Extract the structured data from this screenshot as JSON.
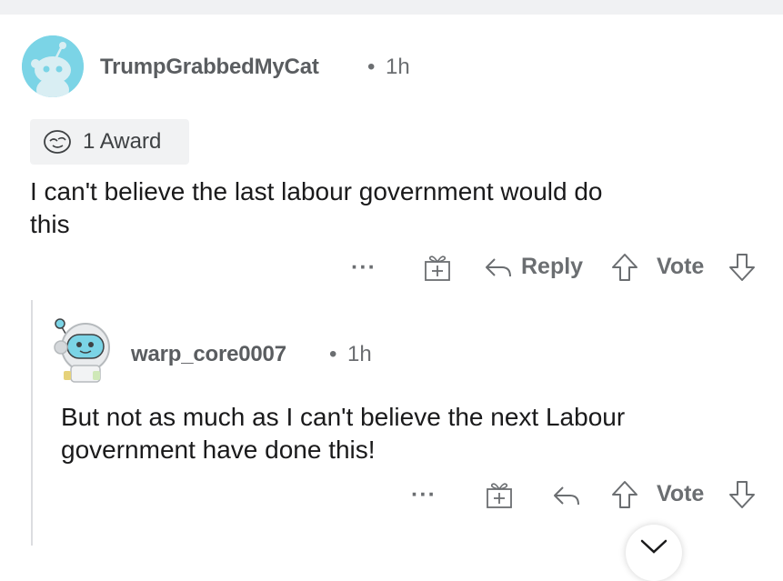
{
  "comment1": {
    "username": "TrumpGrabbedMyCat",
    "separator": "•",
    "time": "1h",
    "award_label": "1 Award",
    "body_line1": "I can't believe the last labour government would do",
    "body_line2": "this",
    "actions": {
      "more": "···",
      "reply": "Reply",
      "vote": "Vote"
    }
  },
  "comment2": {
    "username": "warp_core0007",
    "separator": "•",
    "time": "1h",
    "body_line1": "But not as much as I can't believe the next Labour",
    "body_line2": "government have done this!",
    "actions": {
      "more": "···",
      "vote": "Vote"
    }
  },
  "icons": [
    "avatar",
    "award-icon",
    "gift-icon",
    "reply-arrow-icon",
    "upvote-icon",
    "downvote-icon",
    "chevron-down-icon"
  ],
  "colors": {
    "avatar1_bg": "#7bd4e6",
    "text_primary": "#1a1a1b",
    "text_secondary": "#6b6e71"
  }
}
